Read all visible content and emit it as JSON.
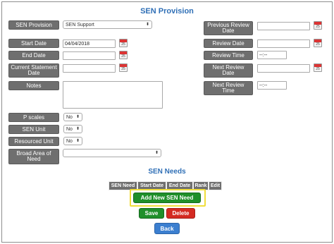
{
  "titles": {
    "main": "SEN Provision",
    "needs": "SEN Needs"
  },
  "left": {
    "sen_provision": {
      "label": "SEN Provision",
      "value": "SEN Support"
    },
    "start_date": {
      "label": "Start Date",
      "value": "04/04/2018"
    },
    "end_date": {
      "label": "End Date",
      "value": ""
    },
    "current_statement_date": {
      "label": "Current Statement Date",
      "value": ""
    },
    "notes": {
      "label": "Notes",
      "value": ""
    },
    "p_scales": {
      "label": "P scales",
      "value": "No"
    },
    "sen_unit": {
      "label": "SEN Unit",
      "value": "No"
    },
    "resourced_unit": {
      "label": "Resourced Unit",
      "value": "No"
    },
    "broad_area": {
      "label": "Broad Area of Need",
      "value": ""
    }
  },
  "right": {
    "previous_review_date": {
      "label": "Previous Review Date",
      "value": ""
    },
    "review_date": {
      "label": "Review Date",
      "value": ""
    },
    "review_time": {
      "label": "Review Time",
      "value": "--:--"
    },
    "next_review_date": {
      "label": "Next Review Date",
      "value": ""
    },
    "next_review_time": {
      "label": "Next Review Time",
      "value": "--:--"
    }
  },
  "calendar_icon_text": "25",
  "dropdown_arrow": "⬍",
  "needs_table": {
    "columns": [
      "SEN Need",
      "Start Date",
      "End Date",
      "Rank",
      "Edit"
    ]
  },
  "buttons": {
    "add_new": "Add New SEN Need",
    "save": "Save",
    "delete": "Delete",
    "back": "Back"
  },
  "colors": {
    "title": "#2f6fb6",
    "label_bg": "#6f6f6f",
    "green": "#1f8f2a",
    "red": "#d42a22",
    "blue": "#3b7fd0",
    "highlight": "#f0dd3b"
  }
}
